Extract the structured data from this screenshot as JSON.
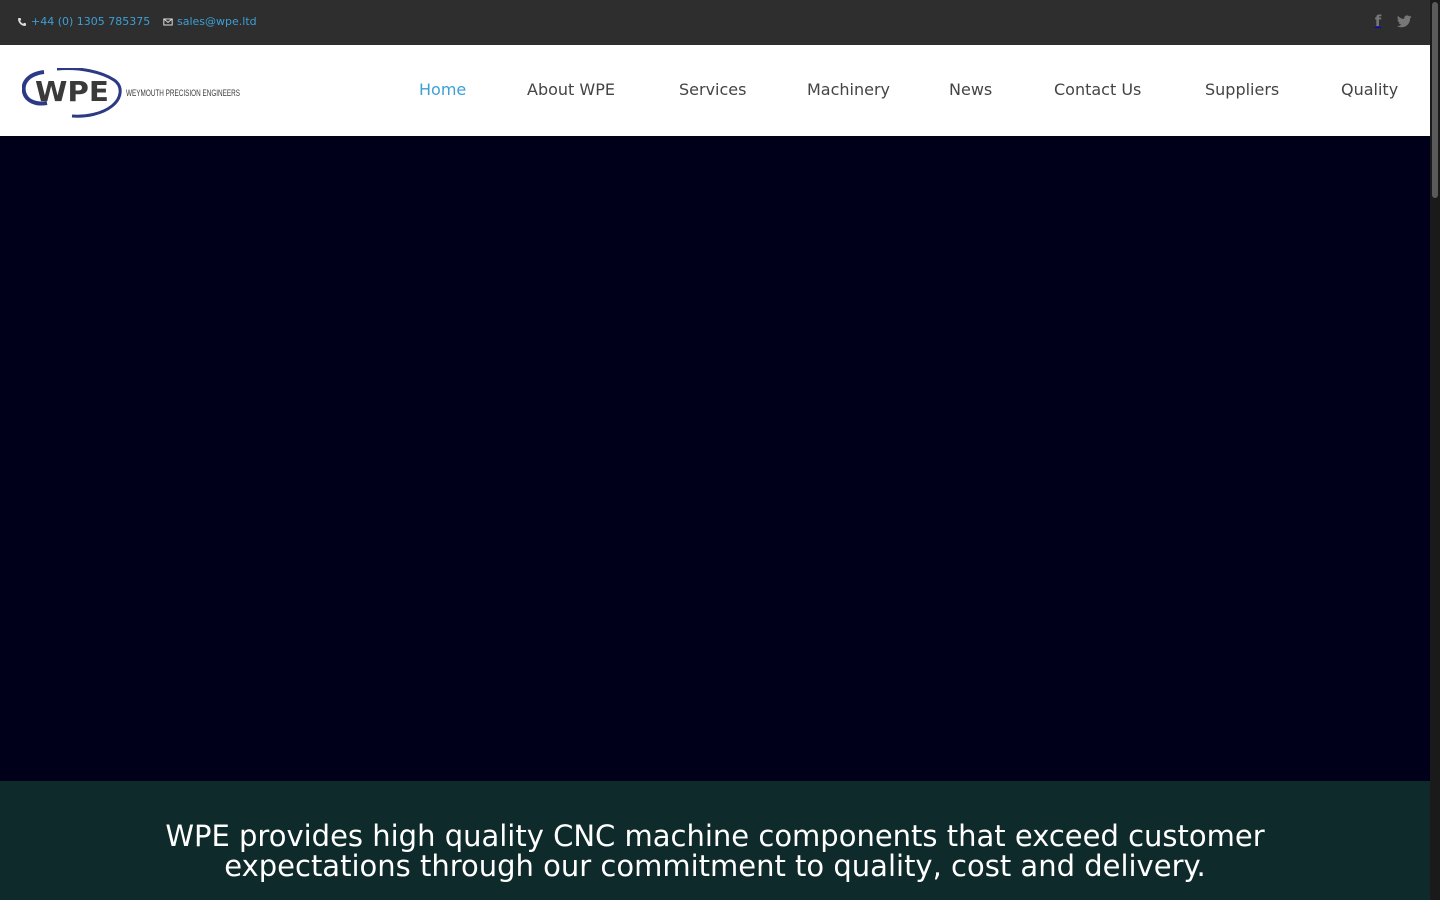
{
  "topbar": {
    "phone": "+44 (0) 1305 785375",
    "email": "sales@wpe.ltd",
    "phone_icon": "phone-icon",
    "email_icon": "mail-icon",
    "social": [
      {
        "icon": "facebook-icon",
        "glyph": "f"
      },
      {
        "icon": "twitter-icon"
      }
    ]
  },
  "logo": {
    "mark": "WPE",
    "text": "WEYMOUTH PRECISION ENGINEERS"
  },
  "nav": {
    "items": [
      {
        "label": "Home",
        "active": true
      },
      {
        "label": "About WPE"
      },
      {
        "label": "Services"
      },
      {
        "label": "Machinery"
      },
      {
        "label": "News"
      },
      {
        "label": "Contact Us"
      },
      {
        "label": "Suppliers"
      },
      {
        "label": "Quality"
      }
    ]
  },
  "band": {
    "line1": "WPE provides high quality CNC machine components that exceed customer",
    "line2": "expectations through our commitment to quality, cost and delivery."
  },
  "colors": {
    "topbar_bg": "#2e2e2e",
    "accent": "#3d9fd6",
    "hero_bg": "#00001a",
    "band_bg": "#0f2a2a",
    "logo_blue": "#2c3a85"
  }
}
